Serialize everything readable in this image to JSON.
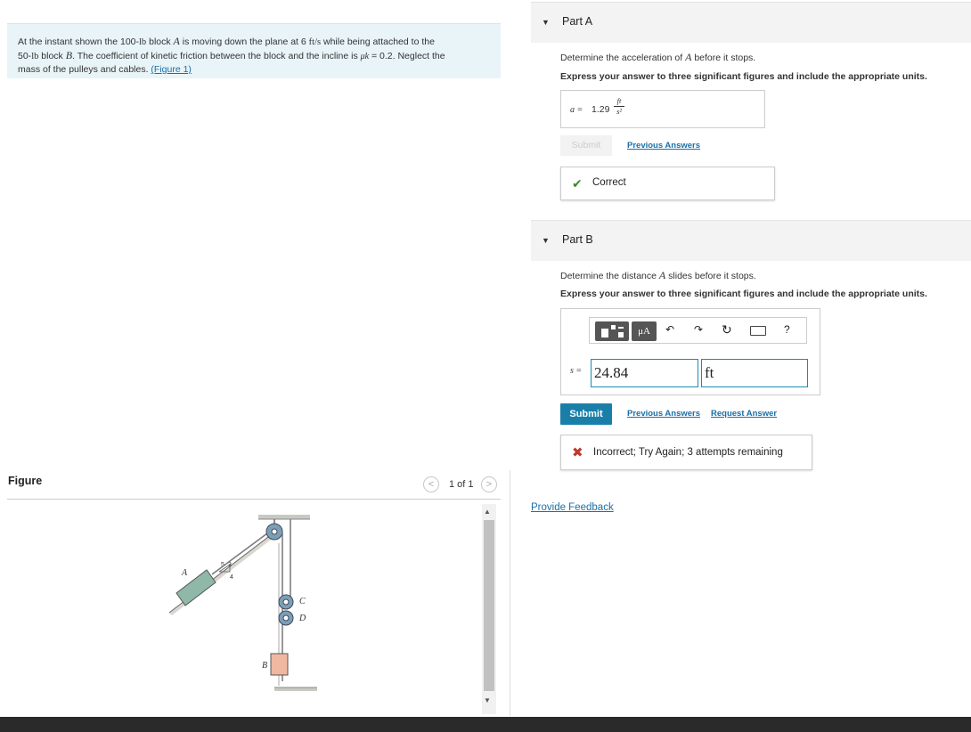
{
  "problem": {
    "text_1": "At the instant shown the 100-",
    "unit_lb_1": "lb",
    "text_2": " block ",
    "var_A": "A",
    "text_3": " is moving down the plane at 6 ",
    "unit_fts": "ft/s",
    "text_4": " while being attached to the",
    "text_5": "50-",
    "unit_lb_2": "lb",
    "text_6": " block ",
    "var_B": "B",
    "text_7": ". The coefficient of kinetic friction between the block and the incline is ",
    "mu_symbol": "μk",
    "text_8": " = 0.2. Neglect the",
    "text_9": "mass of the pulleys and cables. ",
    "figure_link": "(Figure 1)"
  },
  "figure": {
    "label": "Figure",
    "prev_icon": "<",
    "next_icon": ">",
    "count": "1 of 1",
    "labels": {
      "A": "A",
      "B": "B",
      "C": "C",
      "D": "D",
      "slope_3": "3",
      "slope_4": "4",
      "slope_5": "5"
    }
  },
  "part_a": {
    "title": "Part A",
    "question_1": "Determine the acceleration of ",
    "question_var": "A",
    "question_2": " before it stops.",
    "instructions": "Express your answer to three significant figures and include the appropriate units.",
    "answer_label": "a =",
    "answer_value": "1.29",
    "answer_unit_num": "ft",
    "answer_unit_den": "s²",
    "submit_label": "Submit",
    "previous_answers": "Previous Answers",
    "feedback": "Correct"
  },
  "part_b": {
    "title": "Part B",
    "question_1": "Determine the distance ",
    "question_var": "A",
    "question_2": " slides before it stops.",
    "instructions": "Express your answer to three significant figures and include the appropriate units.",
    "toolbar": {
      "mu_label": "μA",
      "help_label": "?"
    },
    "answer_label": "s =",
    "answer_value": "24.84",
    "answer_unit": "ft",
    "submit_label": "Submit",
    "previous_answers": "Previous Answers",
    "request_answer": "Request Answer",
    "feedback": "Incorrect; Try Again; 3 attempts remaining"
  },
  "provide_feedback": "Provide Feedback",
  "colors": {
    "accent": "#1a7fa8",
    "correct": "#3a8a2a",
    "incorrect": "#c0392b",
    "problem_bg": "#e8f4f8",
    "block_a": "#8fb8a8",
    "block_b": "#f0b8a0"
  }
}
